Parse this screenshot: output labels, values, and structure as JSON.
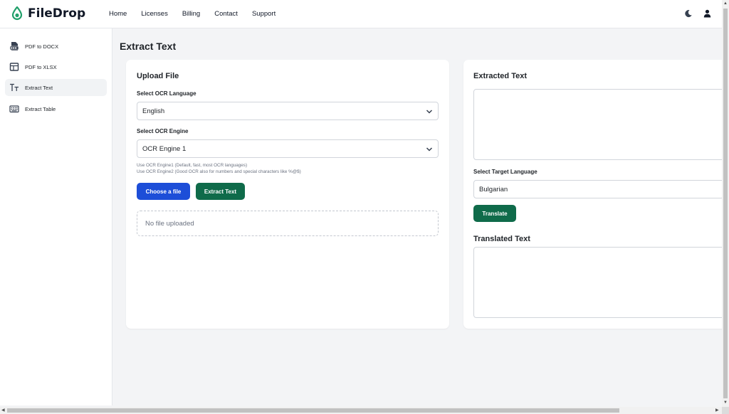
{
  "header": {
    "brand": "FileDrop",
    "nav": [
      "Home",
      "Licenses",
      "Billing",
      "Contact",
      "Support"
    ]
  },
  "sidebar": {
    "items": [
      {
        "label": "PDF to DOCX",
        "icon": "docx-file-icon"
      },
      {
        "label": "PDF to XLSX",
        "icon": "table-layout-icon"
      },
      {
        "label": "Extract Text",
        "icon": "text-format-icon"
      },
      {
        "label": "Extract Table",
        "icon": "keyboard-table-icon"
      }
    ],
    "active": "Extract Text"
  },
  "main": {
    "page_title": "Extract Text",
    "upload": {
      "title": "Upload File",
      "ocr_language_label": "Select OCR Language",
      "ocr_language_value": "English",
      "ocr_engine_label": "Select OCR Engine",
      "ocr_engine_value": "OCR Engine 1",
      "help_line1": "Use OCR Engine1 (Default, fast, most OCR languages)",
      "help_line2": "Use OCR Engine2 (Good OCR also for numbers and special characters like %@$)",
      "choose_button": "Choose a file",
      "extract_button": "Extract Text",
      "dropzone_text": "No file uploaded"
    },
    "result": {
      "extracted_title": "Extracted Text",
      "target_language_label": "Select Target Language",
      "target_language_value": "Bulgarian",
      "translate_button": "Translate",
      "translated_title": "Translated Text"
    }
  },
  "colors": {
    "brand_green": "#22a06b",
    "primary_blue": "#1d4ed8",
    "action_green": "#0f6b4a"
  }
}
